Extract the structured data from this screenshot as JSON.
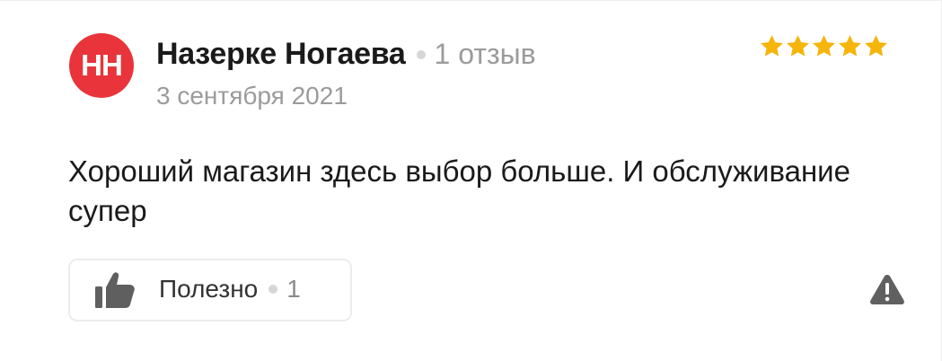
{
  "review": {
    "avatar_initials": "НН",
    "avatar_color": "#e8343a",
    "author_name": "Назерке Ногаева",
    "review_count": "1 отзыв",
    "date": "3 сентября 2021",
    "rating": 5,
    "rating_max": 5,
    "star_color": "#f5b50a",
    "text": "Хороший магазин здесь выбор больше. И обслуживание супер",
    "helpful_label": "Полезно",
    "helpful_count": "1",
    "icons": {
      "helpful": "thumbs-up-icon",
      "report": "warning-triangle-icon"
    }
  }
}
